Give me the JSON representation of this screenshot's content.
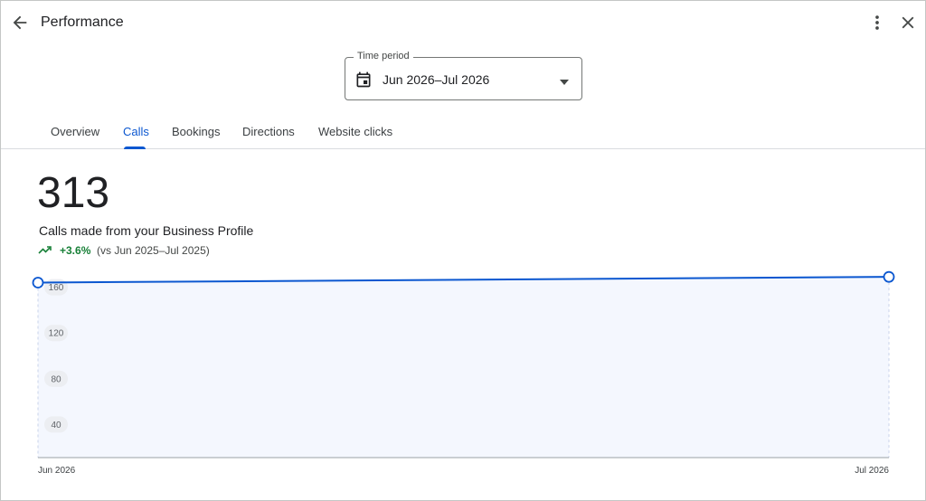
{
  "header": {
    "title": "Performance",
    "back_icon": "arrow-back-icon",
    "more_icon": "more-vert-icon",
    "close_icon": "close-icon"
  },
  "time_period": {
    "legend": "Time period",
    "value": "Jun 2026–Jul 2026",
    "icon": "calendar-icon"
  },
  "tabs": [
    {
      "label": "Overview",
      "active": false
    },
    {
      "label": "Calls",
      "active": true
    },
    {
      "label": "Bookings",
      "active": false
    },
    {
      "label": "Directions",
      "active": false
    },
    {
      "label": "Website clicks",
      "active": false
    }
  ],
  "metric": {
    "value": "313",
    "description": "Calls made from your Business Profile",
    "change": "+3.6%",
    "comparison": "(vs Jun 2025–Jul 2025)",
    "trend_icon": "trending-up-icon"
  },
  "colors": {
    "accent": "#0b57d0",
    "positive": "#188038",
    "area_fill": "#f4f7fe"
  },
  "chart_data": {
    "type": "area",
    "x": [
      "Jun 2026",
      "Jul 2026"
    ],
    "series": [
      {
        "values": [
          153,
          158
        ]
      }
    ],
    "ylim": [
      0,
      170
    ],
    "y_ticks": [
      40,
      80,
      120,
      160
    ],
    "grid": false
  }
}
